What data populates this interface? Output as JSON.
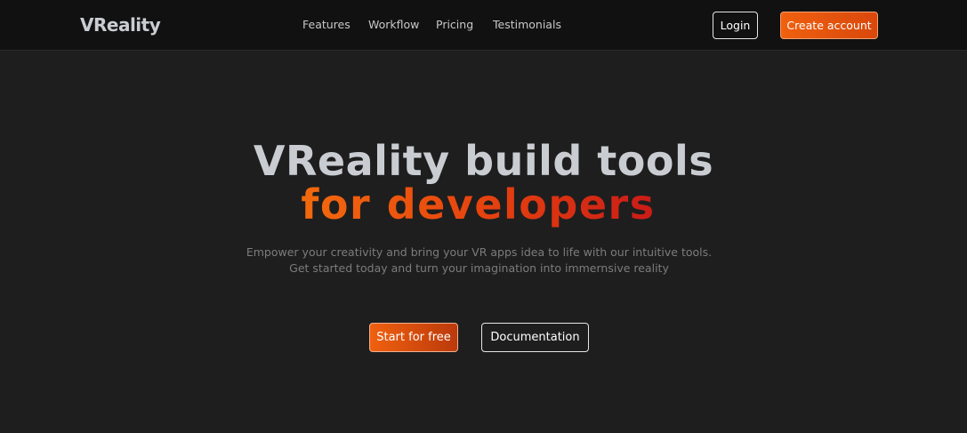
{
  "header": {
    "logo": "VReality",
    "nav": [
      {
        "label": "Features"
      },
      {
        "label": "Workflow"
      },
      {
        "label": "Pricing"
      },
      {
        "label": "Testimonials"
      }
    ],
    "login_label": "Login",
    "create_account_label": "Create account"
  },
  "hero": {
    "title_line1": "VReality build tools",
    "title_line2": "for developers",
    "subtitle_line1": "Empower your creativity and bring your VR apps idea to life with our intuitive tools.",
    "subtitle_line2": "Get started today and turn your imagination into immernsive reality",
    "primary_cta": "Start for free",
    "secondary_cta": "Documentation"
  },
  "colors": {
    "background": "#1e1e1e",
    "navbar": "#111111",
    "accent_start": "#f26a0d",
    "accent_end": "#c91b17",
    "title_gray": "#c9cdd2"
  }
}
